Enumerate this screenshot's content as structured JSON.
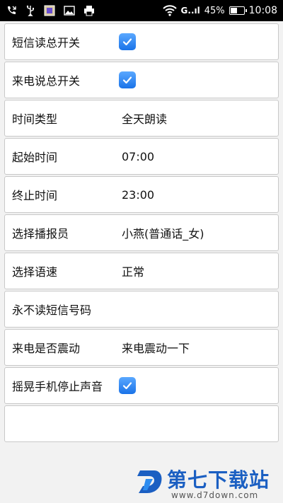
{
  "status_bar": {
    "signal": "G..ıl",
    "battery_percent": "45%",
    "time": "10:08",
    "icons": [
      "missed-call-icon",
      "usb-icon",
      "app-notification-icon",
      "image-icon",
      "printer-icon",
      "wifi-icon",
      "signal-icon",
      "battery-charging-icon"
    ]
  },
  "settings": {
    "sms_master": {
      "label": "短信读总开关",
      "checked": true
    },
    "call_master": {
      "label": "来电说总开关",
      "checked": true
    },
    "time_type": {
      "label": "时间类型",
      "value": "全天朗读"
    },
    "start_time": {
      "label": "起始时间",
      "value": "07:00"
    },
    "end_time": {
      "label": "终止时间",
      "value": "23:00"
    },
    "announcer": {
      "label": "选择播报员",
      "value": "小燕(普通话_女)"
    },
    "speech_rate": {
      "label": "选择语速",
      "value": "正常"
    },
    "never_read_numbers": {
      "label": "永不读短信号码"
    },
    "call_vibrate": {
      "label": "来电是否震动",
      "value": "来电震动一下"
    },
    "shake_stop": {
      "label": "摇晃手机停止声音",
      "checked": true
    }
  },
  "watermark": {
    "title": "第七下载站",
    "url": "www.d7down.com"
  },
  "colors": {
    "checkbox": "#1a73e8",
    "watermark": "#1b5fc2"
  }
}
